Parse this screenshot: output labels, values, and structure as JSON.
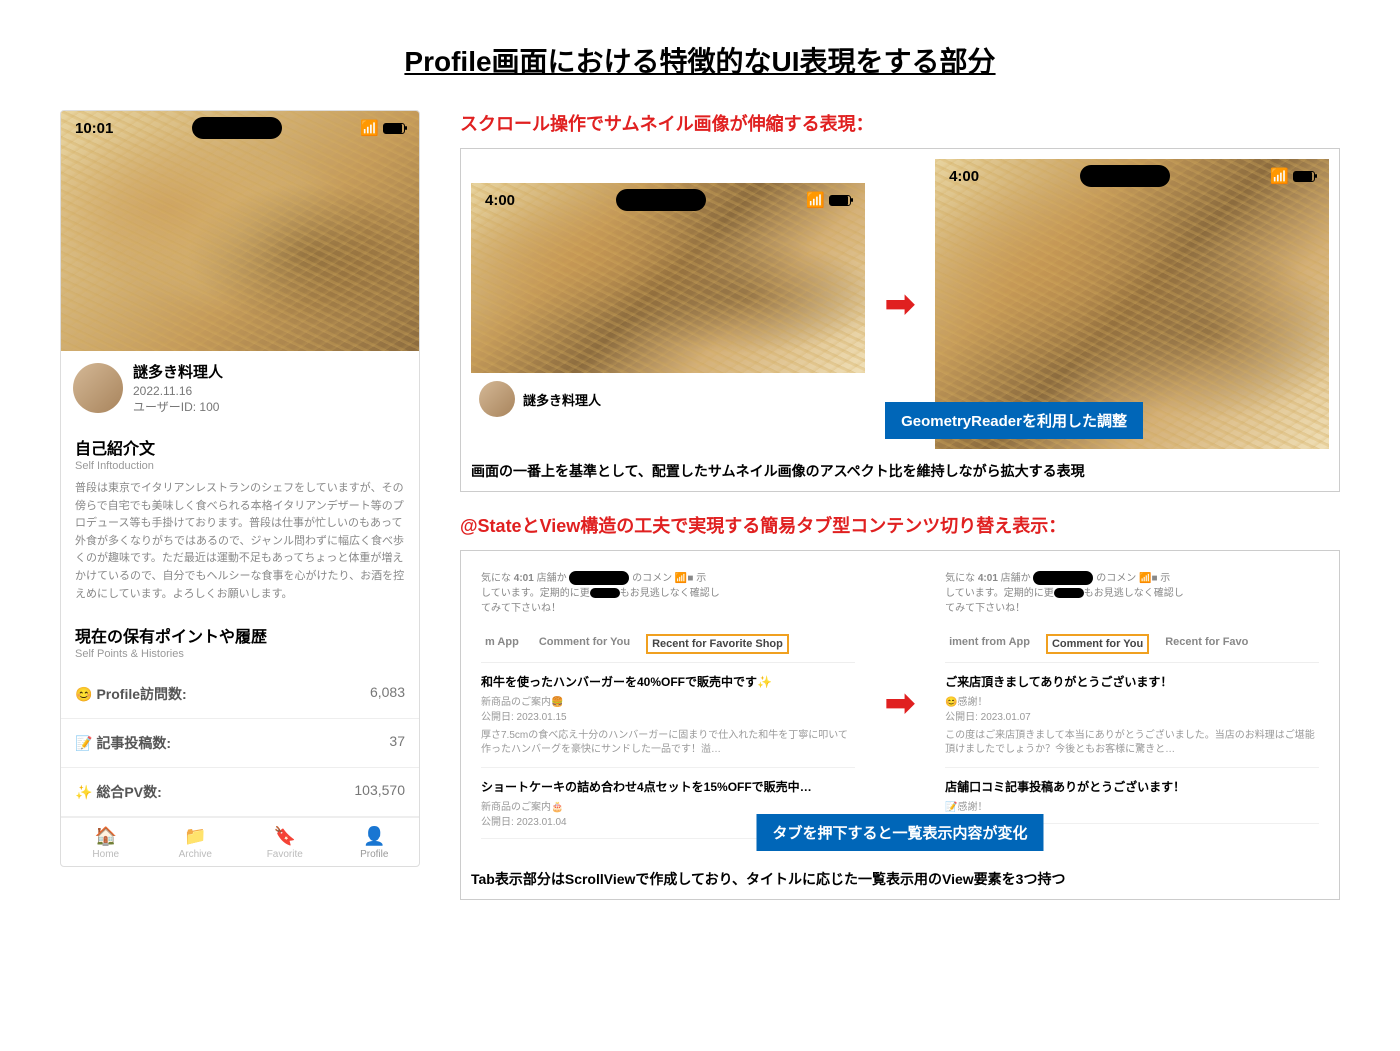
{
  "page_title": "Profile画面における特徴的なUI表現をする部分",
  "left_phone": {
    "time": "10:01",
    "profile_name": "謎多き料理人",
    "profile_date": "2022.11.16",
    "profile_id": "ユーザーID: 100",
    "intro_title": "自己紹介文",
    "intro_sub": "Self Inftoduction",
    "intro_text": "普段は東京でイタリアンレストランのシェフをしていますが、その傍らで自宅でも美味しく食べられる本格イタリアンデザート等のプロデュース等も手掛けております。普段は仕事が忙しいのもあって外食が多くなりがちではあるので、ジャンル問わずに幅広く食べ歩くのが趣味です。ただ最近は運動不足もあってちょっと体重が増えかけているので、自分でもヘルシーな食事を心がけたり、お酒を控えめにしています。よろしくお願いします。",
    "history_title": "現在の保有ポイントや履歴",
    "history_sub": "Self Points & Histories",
    "stats": [
      {
        "icon": "😊",
        "label": "Profile訪問数:",
        "value": "6,083"
      },
      {
        "icon": "📝",
        "label": "記事投稿数:",
        "value": "37"
      },
      {
        "icon": "✨",
        "label": "総合PV数:",
        "value": "103,570"
      }
    ],
    "tabs": [
      {
        "icon": "🏠",
        "label": "Home"
      },
      {
        "icon": "📁",
        "label": "Archive"
      },
      {
        "icon": "🔖",
        "label": "Favorite"
      },
      {
        "icon": "👤",
        "label": "Profile"
      }
    ]
  },
  "section1": {
    "header": "スクロール操作でサムネイル画像が伸縮する表現：",
    "phone1_time": "4:00",
    "phone2_time": "4:00",
    "profile_name": "謎多き料理人",
    "blue_label": "GeometryReaderを利用した調整",
    "caption": "画面の一番上を基準として、配置したサムネイル画像のアスペクト比を維持しながら拡大する表現"
  },
  "section2": {
    "header": "@StateとView構造の工夫で実現する簡易タブ型コンテンツ切り替え表示：",
    "phone1": {
      "time": "4:01",
      "header_text_1": "気にな",
      "header_text_2": "店舗か",
      "header_text_3": "のコメン",
      "header_text_4": "示",
      "header_line2_1": "しています。定期的に更",
      "header_line2_2": "もお見逃しなく確認し",
      "header_line3": "てみて下さいね！",
      "tabs": [
        "m App",
        "Comment for You",
        "Recent for Favorite Shop"
      ],
      "selected_tab": 2,
      "items": [
        {
          "title": "和牛を使ったハンバーガーを40%OFFで販売中です✨",
          "sub": "新商品のご案内🍔",
          "date": "公開日: 2023.01.15",
          "desc": "厚さ7.5cmの食べ応え十分のハンバーガーに固まりで仕入れた和牛を丁寧に叩いて作ったハンバーグを豪快にサンドした一品です！溢…"
        },
        {
          "title": "ショートケーキの詰め合わせ4点セットを15%OFFで販売中…",
          "sub": "新商品のご案内🎂",
          "date": "公開日: 2023.01.04"
        }
      ]
    },
    "phone2": {
      "time": "4:01",
      "header_text_1": "気にな",
      "header_text_2": "店舗か",
      "header_text_3": "のコメン",
      "header_text_4": "示",
      "header_line2_1": "しています。定期的に更",
      "header_line2_2": "もお見逃しなく確認し",
      "header_line3": "てみて下さいね！",
      "tabs": [
        "iment from App",
        "Comment for You",
        "Recent for Favo"
      ],
      "selected_tab": 1,
      "items": [
        {
          "title": "ご来店頂きましてありがとうございます！",
          "sub": "😊感謝！",
          "date": "公開日: 2023.01.07",
          "desc": "この度はご来店頂きまして本当にありがとうございました。当店のお料理はご堪能頂けましたでしょうか？今後ともお客様に驚きと…"
        },
        {
          "title": "店舗口コミ記事投稿ありがとうございます！",
          "sub": "📝感謝！"
        }
      ]
    },
    "blue_label": "タブを押下すると一覧表示内容が変化",
    "caption": "Tab表示部分はScrollViewで作成しており、タイトルに応じた一覧表示用のView要素を3つ持つ"
  }
}
